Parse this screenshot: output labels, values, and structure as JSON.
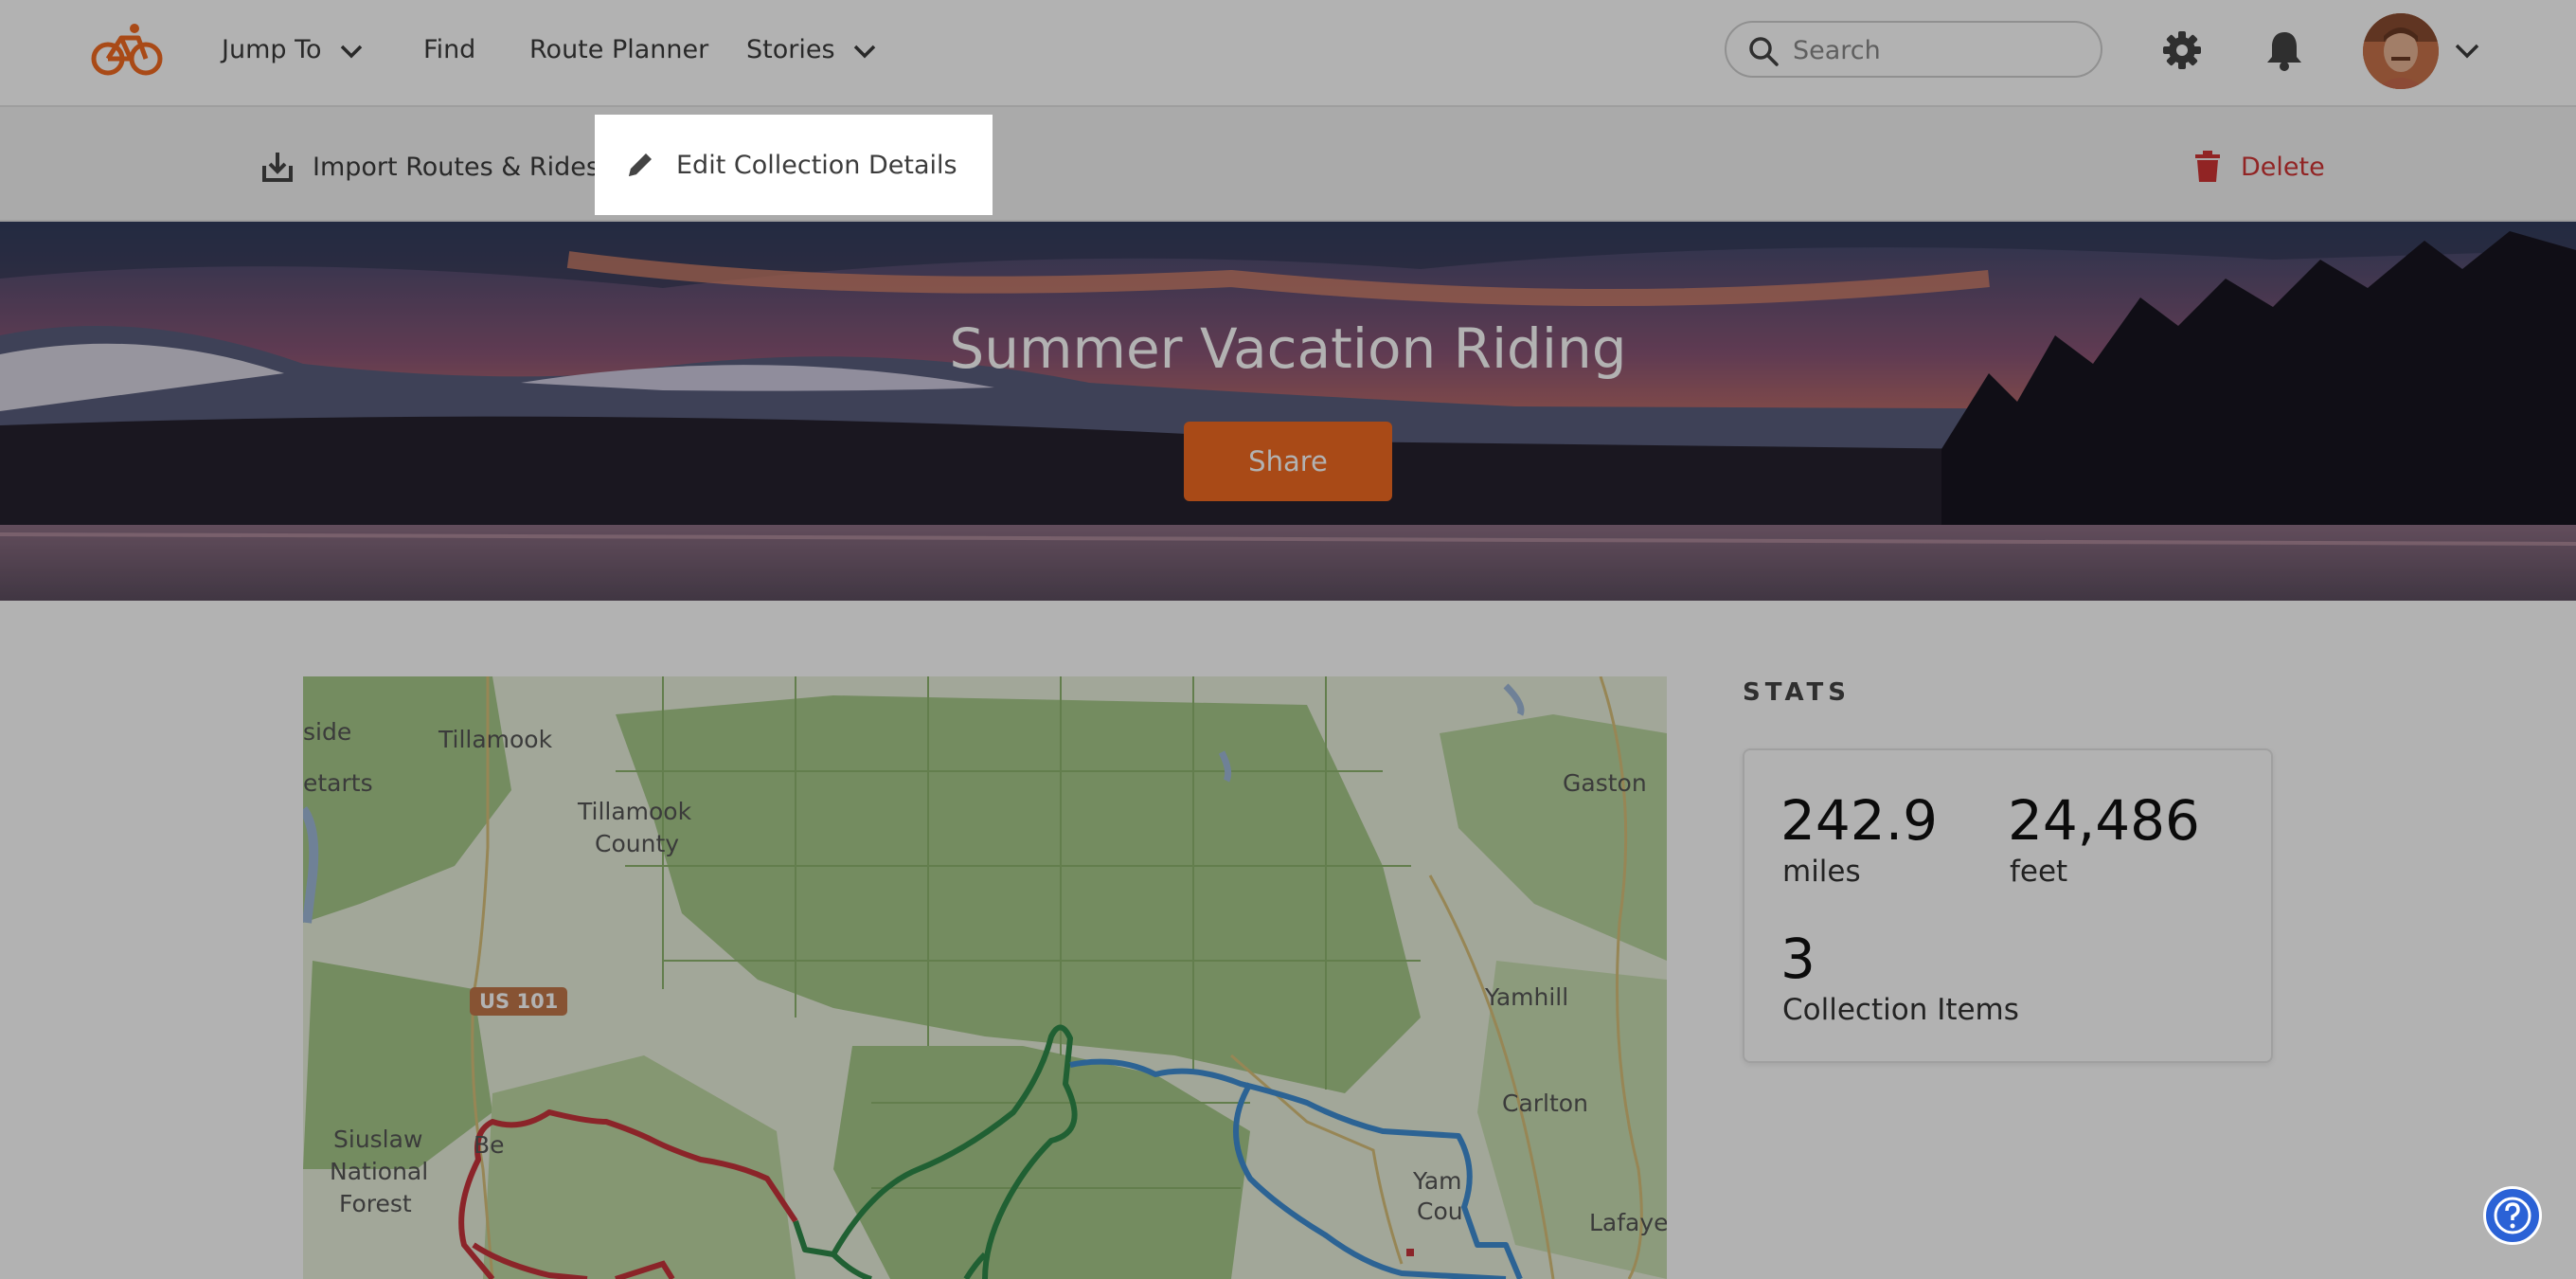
{
  "nav": {
    "logo": "ride-logo",
    "jump_to": "Jump To",
    "find": "Find",
    "route_planner": "Route Planner",
    "stories": "Stories",
    "search_placeholder": "Search"
  },
  "toolbar": {
    "import": "Import Routes & Rides",
    "edit": "Edit Collection Details",
    "delete": "Delete"
  },
  "hero": {
    "title": "Summer Vacation Riding",
    "share": "Share"
  },
  "map": {
    "labels": {
      "side": "side",
      "etarts": "etarts",
      "tillamook": "Tillamook",
      "tillamook_county_1": "Tillamook",
      "tillamook_county_2": "County",
      "gaston": "Gaston",
      "yamhill": "Yamhill",
      "carlton": "Carlton",
      "siuslaw_1": "Siuslaw",
      "siuslaw_2": "National",
      "siuslaw_3": "Forest",
      "be": "Be",
      "yam": "Yam",
      "cou": "Cou",
      "lafaye": "Lafaye",
      "us101": "US 101"
    },
    "route_colors": [
      "#c8343c",
      "#2f8a4a",
      "#3f8ed4"
    ]
  },
  "stats": {
    "heading": "STATS",
    "miles_value": "242.9",
    "miles_unit": "miles",
    "feet_value": "24,486",
    "feet_unit": "feet",
    "items_value": "3",
    "items_unit": "Collection Items"
  },
  "colors": {
    "accent": "#f26a22",
    "delete": "#d03434",
    "help": "#2b62d6"
  }
}
